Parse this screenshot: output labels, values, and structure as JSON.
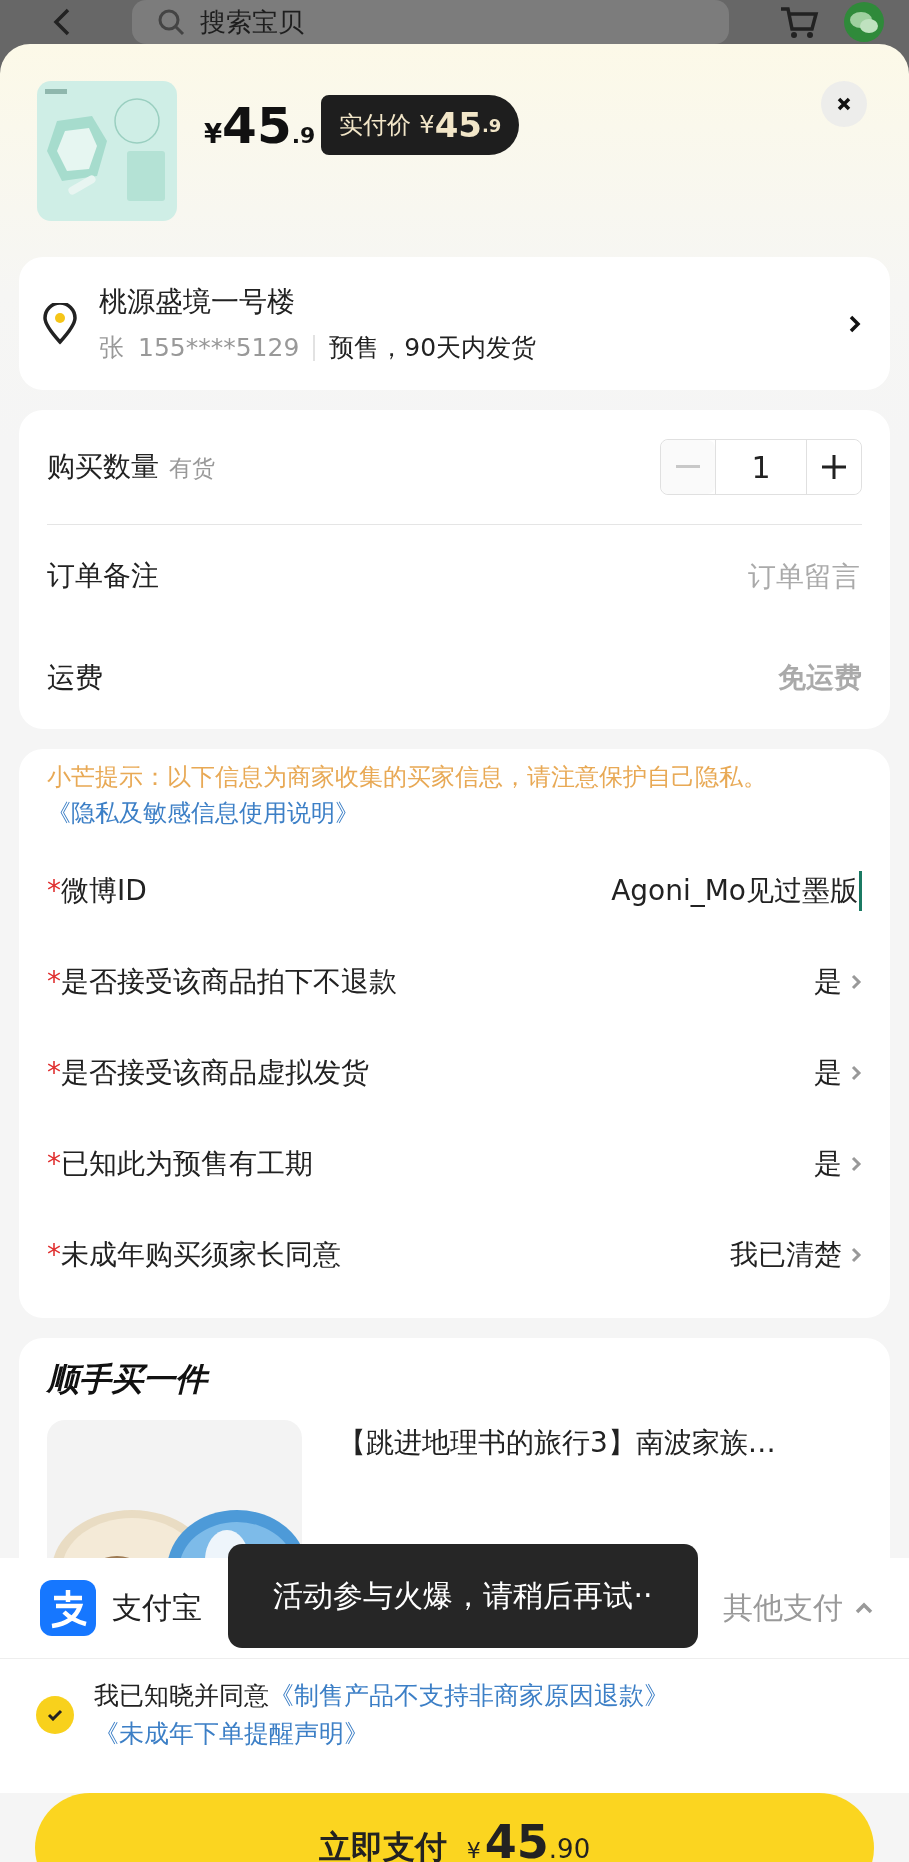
{
  "top_bar": {
    "search_placeholder": "搜索宝贝"
  },
  "product": {
    "kind": "picture",
    "price_symbol": "¥",
    "price_int": "45",
    "price_dec": ".9",
    "paid_label": "实付价",
    "paid_symbol": "¥",
    "paid_int": "45",
    "paid_dec": ".9"
  },
  "address": {
    "title": "桃源盛境一号楼",
    "name": "张",
    "phone": "155****5129",
    "shipping": "预售，90天内发货"
  },
  "order": {
    "quantity_label": "购买数量",
    "stock": "有货",
    "quantity": "1",
    "minus_disabled": true,
    "note_label": "订单备注",
    "note_placeholder": "订单留言",
    "shipping_label": "运费",
    "shipping_value": "免运费"
  },
  "buyer_info": {
    "hint": "小芒提示：以下信息为商家收集的买家信息，请注意保护自己隐私。",
    "hint_link": "《隐私及敏感信息使用说明》",
    "fields": [
      {
        "kind": "input",
        "required_mark": "*",
        "label": "微博ID",
        "value": "Agoni_Mo见过墨版"
      },
      {
        "kind": "select",
        "required_mark": "*",
        "label": "是否接受该商品拍下不退款",
        "value": "是"
      },
      {
        "kind": "select",
        "required_mark": "*",
        "label": "是否接受该商品虚拟发货",
        "value": "是"
      },
      {
        "kind": "select",
        "required_mark": "*",
        "label": "已知此为预售有工期",
        "value": "是"
      },
      {
        "kind": "select",
        "required_mark": "*",
        "label": "未成年购买须家长同意",
        "value": "我已清楚"
      }
    ]
  },
  "upsell": {
    "title": "顺手买一件",
    "items": [
      {
        "kind": "picture",
        "title": "【跳进地理书的旅行3】南波家族…"
      }
    ]
  },
  "payment": {
    "method": "支付宝",
    "other": "其他支付"
  },
  "toast": "活动参与火爆，请稍后再试··",
  "agreement": {
    "checked": true,
    "text": "我已知晓并同意",
    "links": [
      "《制售产品不支持非商家原因退款》",
      "《未成年下单提醒声明》"
    ]
  },
  "pay_button": {
    "label": "立即支付",
    "symbol": "¥",
    "int": "45",
    "dec": ".90"
  }
}
